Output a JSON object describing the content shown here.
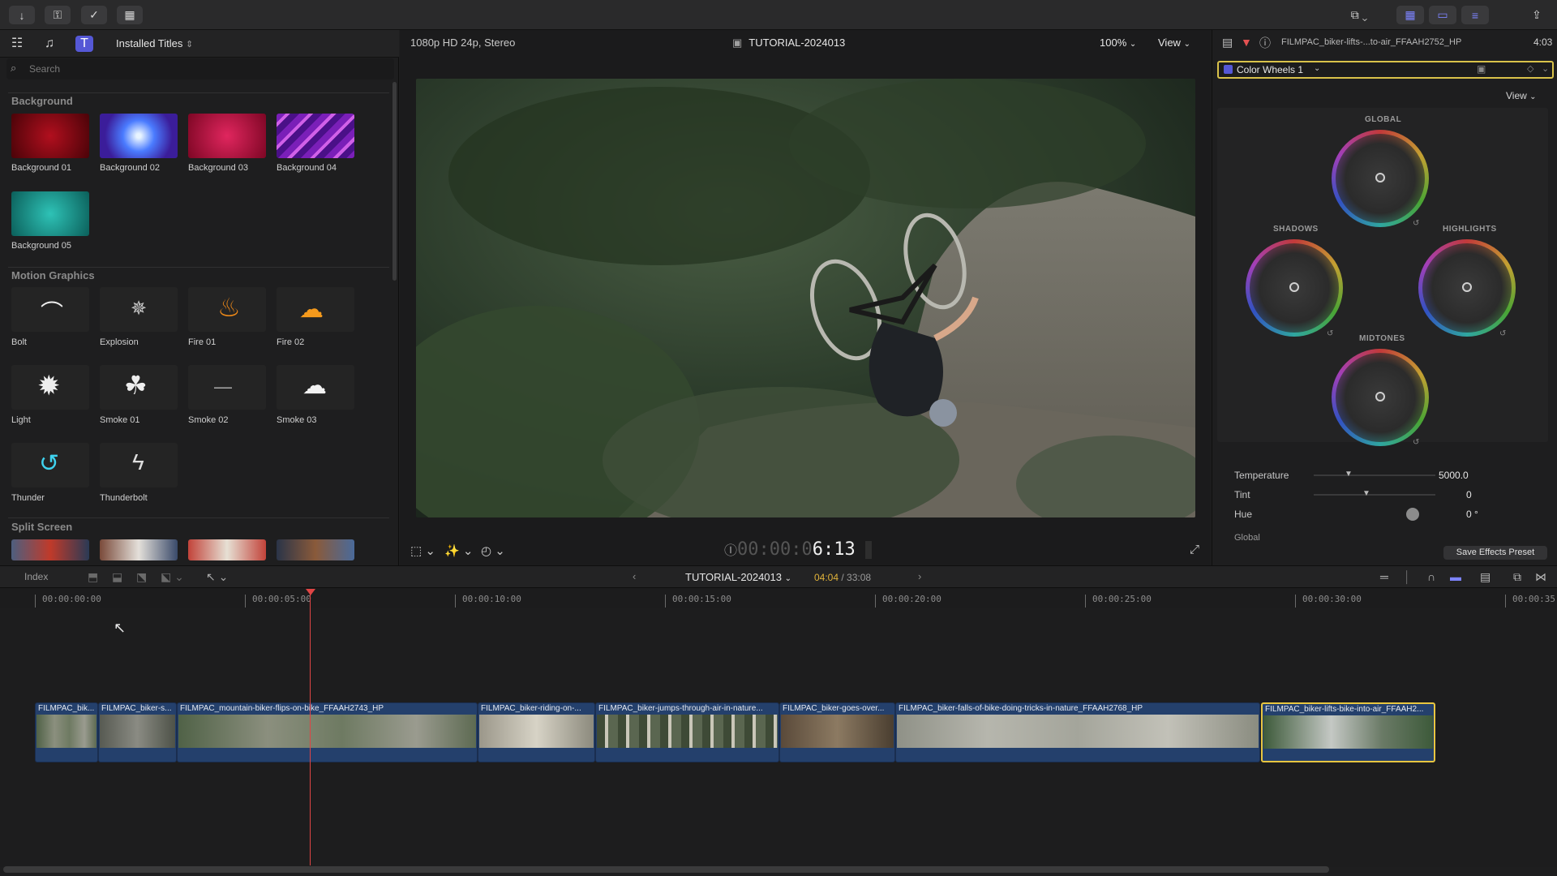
{
  "toolbar": {
    "left_buttons": [
      "import-icon",
      "keywords-icon",
      "check-icon",
      "layout-icon"
    ],
    "right_buttons": [
      "view-switch-icon",
      "grid-icon",
      "clip-appearance-icon",
      "inspector-icon",
      "share-icon"
    ]
  },
  "browser": {
    "library_dropdown": "Installed Titles",
    "search_placeholder": "Search",
    "sections": [
      {
        "title": "Background",
        "items": [
          {
            "label": "Background 01",
            "color": "#8e0c16"
          },
          {
            "label": "Background 02",
            "color": "#5a6dff"
          },
          {
            "label": "Background 03",
            "color": "#c9144a"
          },
          {
            "label": "Background 04",
            "color": "#b24ad4"
          },
          {
            "label": "Background 05",
            "color": "#1aa39a"
          }
        ]
      },
      {
        "title": "Motion Graphics",
        "items": [
          {
            "label": "Bolt",
            "glyph": "⌒"
          },
          {
            "label": "Explosion",
            "glyph": "✵"
          },
          {
            "label": "Fire 01",
            "glyph": "♨"
          },
          {
            "label": "Fire 02",
            "glyph": "☁"
          },
          {
            "label": "Light",
            "glyph": "✹"
          },
          {
            "label": "Smoke 01",
            "glyph": "☘"
          },
          {
            "label": "Smoke 02",
            "glyph": "–"
          },
          {
            "label": "Smoke 03",
            "glyph": "☁"
          },
          {
            "label": "Thunder",
            "glyph": "↺"
          },
          {
            "label": "Thunderbolt",
            "glyph": "ϟ"
          }
        ]
      },
      {
        "title": "Split Screen",
        "items": []
      }
    ]
  },
  "viewer": {
    "format": "1080p HD 24p, Stereo",
    "project": "TUTORIAL-2024013",
    "zoom": "100%",
    "view": "View",
    "timecode_dim": "00:00:0",
    "timecode": "6:13"
  },
  "inspector": {
    "clip_name": "FILMPAC_biker-lifts-...to-air_FFAAH2752_HP",
    "duration": "4:03",
    "effect": "Color Wheels 1",
    "view": "View",
    "wheels": {
      "global": "GLOBAL",
      "shadows": "SHADOWS",
      "highlights": "HIGHLIGHTS",
      "midtones": "MIDTONES"
    },
    "params": [
      {
        "label": "Temperature",
        "value": "5000.0"
      },
      {
        "label": "Tint",
        "value": "0"
      },
      {
        "label": "Hue",
        "value": "0 °"
      }
    ],
    "cut_label": "Global",
    "save_preset": "Save Effects Preset"
  },
  "timeline": {
    "index": "Index",
    "project": "TUTORIAL-2024013",
    "position": "04:04",
    "duration": "/ 33:08",
    "ruler": [
      "00:00:00:00",
      "00:00:05:00",
      "00:00:10:00",
      "00:00:15:00",
      "00:00:20:00",
      "00:00:25:00",
      "00:00:30:00",
      "00:00:35:"
    ],
    "clips": [
      "FILMPAC_bik...",
      "FILMPAC_biker-s...",
      "FILMPAC_mountain-biker-flips-on-bike_FFAAH2743_HP",
      "FILMPAC_biker-riding-on-...",
      "FILMPAC_biker-jumps-through-air-in-nature...",
      "FILMPAC_biker-goes-over...",
      "FILMPAC_biker-falls-of-bike-doing-tricks-in-nature_FFAAH2768_HP",
      "FILMPAC_biker-lifts-bike-into-air_FFAAH2..."
    ]
  }
}
